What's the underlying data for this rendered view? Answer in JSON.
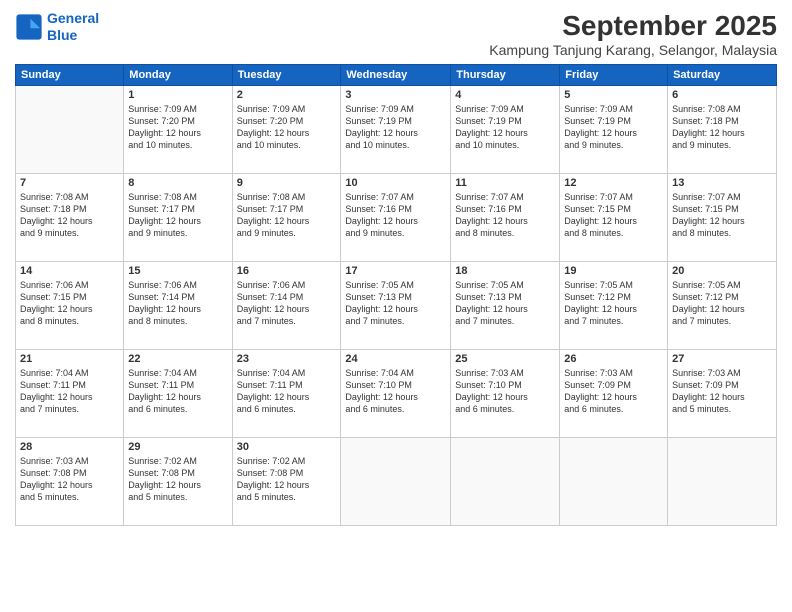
{
  "logo": {
    "line1": "General",
    "line2": "Blue"
  },
  "title": "September 2025",
  "subtitle": "Kampung Tanjung Karang, Selangor, Malaysia",
  "days_header": [
    "Sunday",
    "Monday",
    "Tuesday",
    "Wednesday",
    "Thursday",
    "Friday",
    "Saturday"
  ],
  "weeks": [
    [
      {
        "day": "",
        "info": ""
      },
      {
        "day": "1",
        "info": "Sunrise: 7:09 AM\nSunset: 7:20 PM\nDaylight: 12 hours\nand 10 minutes."
      },
      {
        "day": "2",
        "info": "Sunrise: 7:09 AM\nSunset: 7:20 PM\nDaylight: 12 hours\nand 10 minutes."
      },
      {
        "day": "3",
        "info": "Sunrise: 7:09 AM\nSunset: 7:19 PM\nDaylight: 12 hours\nand 10 minutes."
      },
      {
        "day": "4",
        "info": "Sunrise: 7:09 AM\nSunset: 7:19 PM\nDaylight: 12 hours\nand 10 minutes."
      },
      {
        "day": "5",
        "info": "Sunrise: 7:09 AM\nSunset: 7:19 PM\nDaylight: 12 hours\nand 9 minutes."
      },
      {
        "day": "6",
        "info": "Sunrise: 7:08 AM\nSunset: 7:18 PM\nDaylight: 12 hours\nand 9 minutes."
      }
    ],
    [
      {
        "day": "7",
        "info": "Sunrise: 7:08 AM\nSunset: 7:18 PM\nDaylight: 12 hours\nand 9 minutes."
      },
      {
        "day": "8",
        "info": "Sunrise: 7:08 AM\nSunset: 7:17 PM\nDaylight: 12 hours\nand 9 minutes."
      },
      {
        "day": "9",
        "info": "Sunrise: 7:08 AM\nSunset: 7:17 PM\nDaylight: 12 hours\nand 9 minutes."
      },
      {
        "day": "10",
        "info": "Sunrise: 7:07 AM\nSunset: 7:16 PM\nDaylight: 12 hours\nand 9 minutes."
      },
      {
        "day": "11",
        "info": "Sunrise: 7:07 AM\nSunset: 7:16 PM\nDaylight: 12 hours\nand 8 minutes."
      },
      {
        "day": "12",
        "info": "Sunrise: 7:07 AM\nSunset: 7:15 PM\nDaylight: 12 hours\nand 8 minutes."
      },
      {
        "day": "13",
        "info": "Sunrise: 7:07 AM\nSunset: 7:15 PM\nDaylight: 12 hours\nand 8 minutes."
      }
    ],
    [
      {
        "day": "14",
        "info": "Sunrise: 7:06 AM\nSunset: 7:15 PM\nDaylight: 12 hours\nand 8 minutes."
      },
      {
        "day": "15",
        "info": "Sunrise: 7:06 AM\nSunset: 7:14 PM\nDaylight: 12 hours\nand 8 minutes."
      },
      {
        "day": "16",
        "info": "Sunrise: 7:06 AM\nSunset: 7:14 PM\nDaylight: 12 hours\nand 7 minutes."
      },
      {
        "day": "17",
        "info": "Sunrise: 7:05 AM\nSunset: 7:13 PM\nDaylight: 12 hours\nand 7 minutes."
      },
      {
        "day": "18",
        "info": "Sunrise: 7:05 AM\nSunset: 7:13 PM\nDaylight: 12 hours\nand 7 minutes."
      },
      {
        "day": "19",
        "info": "Sunrise: 7:05 AM\nSunset: 7:12 PM\nDaylight: 12 hours\nand 7 minutes."
      },
      {
        "day": "20",
        "info": "Sunrise: 7:05 AM\nSunset: 7:12 PM\nDaylight: 12 hours\nand 7 minutes."
      }
    ],
    [
      {
        "day": "21",
        "info": "Sunrise: 7:04 AM\nSunset: 7:11 PM\nDaylight: 12 hours\nand 7 minutes."
      },
      {
        "day": "22",
        "info": "Sunrise: 7:04 AM\nSunset: 7:11 PM\nDaylight: 12 hours\nand 6 minutes."
      },
      {
        "day": "23",
        "info": "Sunrise: 7:04 AM\nSunset: 7:11 PM\nDaylight: 12 hours\nand 6 minutes."
      },
      {
        "day": "24",
        "info": "Sunrise: 7:04 AM\nSunset: 7:10 PM\nDaylight: 12 hours\nand 6 minutes."
      },
      {
        "day": "25",
        "info": "Sunrise: 7:03 AM\nSunset: 7:10 PM\nDaylight: 12 hours\nand 6 minutes."
      },
      {
        "day": "26",
        "info": "Sunrise: 7:03 AM\nSunset: 7:09 PM\nDaylight: 12 hours\nand 6 minutes."
      },
      {
        "day": "27",
        "info": "Sunrise: 7:03 AM\nSunset: 7:09 PM\nDaylight: 12 hours\nand 5 minutes."
      }
    ],
    [
      {
        "day": "28",
        "info": "Sunrise: 7:03 AM\nSunset: 7:08 PM\nDaylight: 12 hours\nand 5 minutes."
      },
      {
        "day": "29",
        "info": "Sunrise: 7:02 AM\nSunset: 7:08 PM\nDaylight: 12 hours\nand 5 minutes."
      },
      {
        "day": "30",
        "info": "Sunrise: 7:02 AM\nSunset: 7:08 PM\nDaylight: 12 hours\nand 5 minutes."
      },
      {
        "day": "",
        "info": ""
      },
      {
        "day": "",
        "info": ""
      },
      {
        "day": "",
        "info": ""
      },
      {
        "day": "",
        "info": ""
      }
    ]
  ]
}
